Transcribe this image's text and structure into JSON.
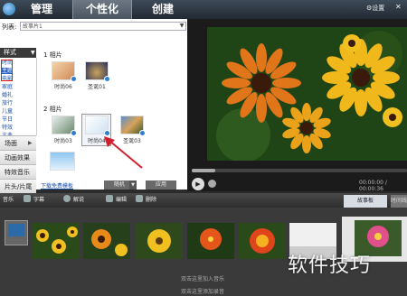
{
  "nav": {
    "manage": "管理",
    "personalize": "个性化",
    "create": "创建",
    "settings": "设置",
    "close": "关闭"
  },
  "project": {
    "label": "列表:",
    "value": "故事片1"
  },
  "style_panel": {
    "header": "样式",
    "items": [
      "时尚",
      "主题",
      "电影",
      "家庭",
      "婚礼",
      "旅行",
      "儿童",
      "节日",
      "特效",
      "古典"
    ],
    "selected_index": 1
  },
  "side_buttons": [
    "场面",
    "动画效果",
    "特效音乐",
    "片头/片尾"
  ],
  "groups": [
    {
      "title": "1 相片",
      "items": [
        {
          "label": "时尚06",
          "selected": false
        },
        {
          "label": "圣诞01",
          "selected": false
        }
      ]
    },
    {
      "title": "2 相片",
      "items": [
        {
          "label": "时尚03",
          "selected": false
        },
        {
          "label": "时尚04",
          "selected": true
        },
        {
          "label": "圣诞03",
          "selected": false
        }
      ]
    },
    {
      "title": "",
      "items": [
        {
          "label": "",
          "selected": false
        }
      ]
    }
  ],
  "bottom_links": {
    "download": "下载免费模板",
    "random": "随机",
    "apply": "应用"
  },
  "player": {
    "time": "00:00:00 / 00:00:36",
    "progress": 0.11
  },
  "toolbar": {
    "music": "音乐",
    "subtitle": "字幕",
    "narration": "解说",
    "edit": "编辑",
    "delete": "删除"
  },
  "view_tabs": {
    "storyboard": "故事板",
    "timeline": "时间线"
  },
  "storyboard_hints": {
    "music": "双击这里加入音乐",
    "record": "双击这里添加录音"
  },
  "watermark": "软件技巧",
  "colors": {
    "accent": "#2a62c9",
    "highlight_box": "#e11111",
    "arrow": "#d21f2e"
  }
}
